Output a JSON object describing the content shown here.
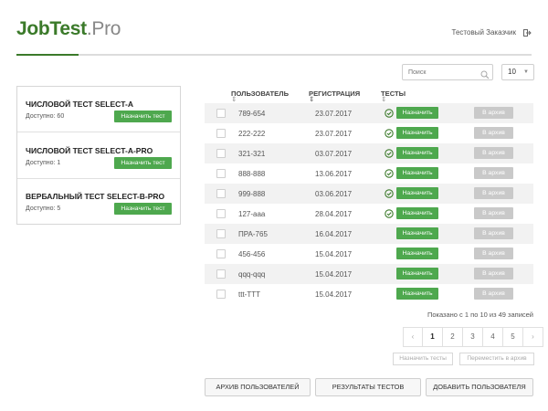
{
  "header": {
    "logo_main": "JobTest",
    "logo_suffix": ".Pro",
    "user_name": "Тестовый Заказчик",
    "logout_icon": "logout-icon"
  },
  "toolbar": {
    "search_placeholder": "Поиск",
    "page_size": "10"
  },
  "tests": [
    {
      "title": "ЧИСЛОВОЙ ТЕСТ SELECT-A",
      "available": "Доступно: 60",
      "button": "Назначить тест"
    },
    {
      "title": "ЧИСЛОВОЙ ТЕСТ SELECT-A-PRO",
      "available": "Доступно: 1",
      "button": "Назначить тест"
    },
    {
      "title": "ВЕРБАЛЬНЫЙ ТЕСТ SELECT-B-PRO",
      "available": "Доступно: 5",
      "button": "Назначить тест"
    }
  ],
  "grid": {
    "columns": {
      "user": "ПОЛЬЗОВАТЕЛЬ",
      "registration": "РЕГИСТРАЦИЯ",
      "tests": "ТЕСТЫ"
    },
    "assign_label": "Назначить",
    "archive_label": "В архив",
    "rows": [
      {
        "user": "789-654",
        "date": "23.07.2017",
        "done": true
      },
      {
        "user": "222-222",
        "date": "23.07.2017",
        "done": true
      },
      {
        "user": "321-321",
        "date": "03.07.2017",
        "done": true
      },
      {
        "user": "888-888",
        "date": "13.06.2017",
        "done": true
      },
      {
        "user": "999-888",
        "date": "03.06.2017",
        "done": true
      },
      {
        "user": "127-aaa",
        "date": "28.04.2017",
        "done": true
      },
      {
        "user": "ПРА-765",
        "date": "16.04.2017",
        "done": false
      },
      {
        "user": "456-456",
        "date": "15.04.2017",
        "done": false
      },
      {
        "user": "qqq-qqq",
        "date": "15.04.2017",
        "done": false
      },
      {
        "user": "ttt-TTT",
        "date": "15.04.2017",
        "done": false
      }
    ],
    "shown_text": "Показано с 1 по 10 из 49 записей"
  },
  "pagination": {
    "prev": "‹",
    "pages": [
      "1",
      "2",
      "3",
      "4",
      "5"
    ],
    "next": "›",
    "active": "1"
  },
  "bulk": {
    "assign_tests": "Назначить тесты",
    "move_archive": "Переместить в архив"
  },
  "footer": {
    "archive_users": "АРХИВ ПОЛЬЗОВАТЕЛЕЙ",
    "test_results": "РЕЗУЛЬТАТЫ ТЕСТОВ",
    "add_user": "ДОБАВИТЬ ПОЛЬЗОВАТЕЛЯ"
  },
  "colors": {
    "brand_green": "#3b7a2a",
    "button_green": "#4ea84e",
    "disabled_gray": "#c9c9c9"
  }
}
